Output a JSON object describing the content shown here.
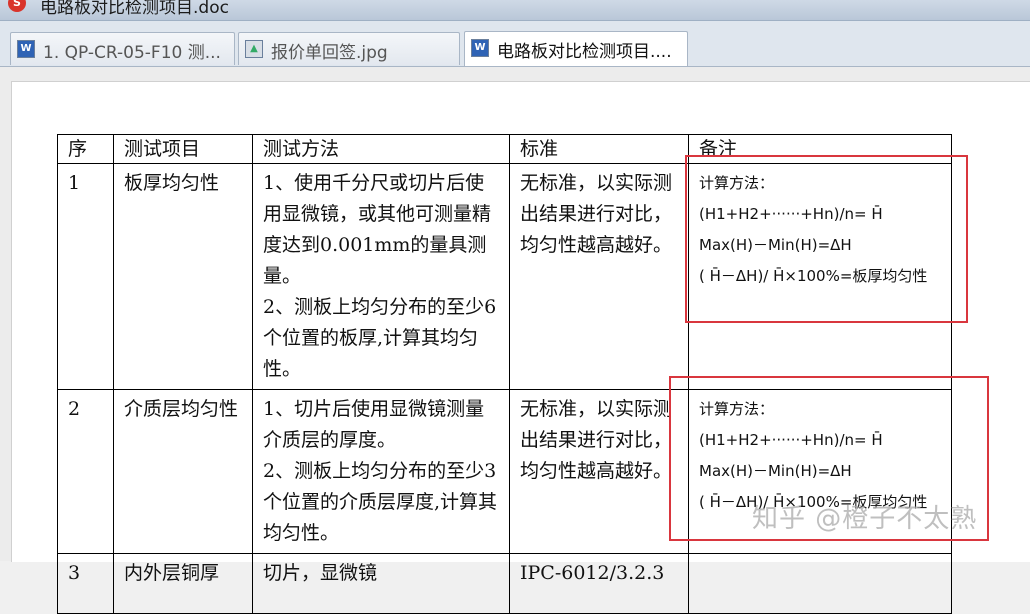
{
  "window": {
    "title": "电路板对比检测项目.doc",
    "app_icon": "wps-icon",
    "app_icon_glyph": "S"
  },
  "tabs": [
    {
      "label": "1. QP-CR-05-F10 测...",
      "icon": "word-doc-icon",
      "glyph": "W"
    },
    {
      "label": "报价单回签.jpg",
      "icon": "image-file-icon",
      "glyph": "▲"
    },
    {
      "label": "电路板对比检测项目....",
      "icon": "word-doc-icon",
      "glyph": "W"
    }
  ],
  "table": {
    "headers": [
      "序",
      "测试项目",
      "测试方法",
      "标准",
      "备注"
    ],
    "rows": [
      {
        "no": "1",
        "item": "板厚均匀性",
        "method": [
          "1、使用千分尺或切片后使用显微镜，或其他可测量精度达到0.001mm的量具测量。",
          "2、测板上均匀分布的至少6个位置的板厚,计算其均匀性。"
        ],
        "standard": "无标准，以实际测出结果进行对比，均匀性越高越好。",
        "note": [
          "计算方法：",
          "(H1+H2+······+Hn)/n= H̄",
          "Max(H)－Min(H)=ΔH",
          "( H̄－ΔH)/ H̄×100%=板厚均匀性"
        ]
      },
      {
        "no": "2",
        "item": "介质层均匀性",
        "method": [
          "1、切片后使用显微镜测量介质层的厚度。",
          "2、测板上均匀分布的至少3个位置的介质层厚度,计算其均匀性。"
        ],
        "standard": "无标准，以实际测出结果进行对比，均匀性越高越好。",
        "note": [
          "计算方法：",
          "(H1+H2+······+Hn)/n= H̄",
          "Max(H)－Min(H)=ΔH",
          "( H̄－ΔH)/ H̄×100%=板厚均匀性"
        ]
      },
      {
        "no": "3",
        "item": "内外层铜厚",
        "method": [
          "切片，显微镜"
        ],
        "standard": "IPC-6012/3.2.3",
        "note": []
      }
    ]
  },
  "watermark": "知乎 @橙子不太熟",
  "colors": {
    "highlight_box": "#d9363e",
    "tab_bar": "#dfe6ee"
  }
}
